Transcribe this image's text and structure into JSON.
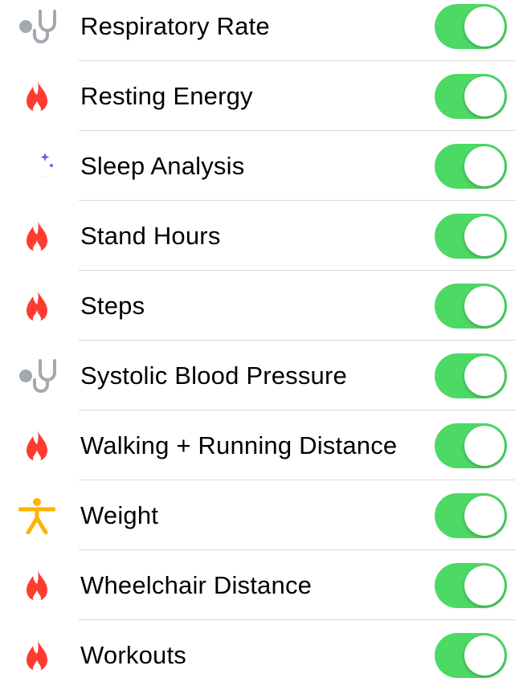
{
  "colors": {
    "toggle_on": "#4cd964",
    "flame": "#ff3b30",
    "moon": "#7d56f5",
    "stethoscope": "#a4a8b0",
    "figure": "#ffb300"
  },
  "items": [
    {
      "label": "Respiratory Rate",
      "icon": "stethoscope-icon",
      "enabled": true
    },
    {
      "label": "Resting Energy",
      "icon": "flame-icon",
      "enabled": true
    },
    {
      "label": "Sleep Analysis",
      "icon": "moon-icon",
      "enabled": true
    },
    {
      "label": "Stand Hours",
      "icon": "flame-icon",
      "enabled": true
    },
    {
      "label": "Steps",
      "icon": "flame-icon",
      "enabled": true
    },
    {
      "label": "Systolic Blood Pressure",
      "icon": "stethoscope-icon",
      "enabled": true
    },
    {
      "label": "Walking + Running Distance",
      "icon": "flame-icon",
      "enabled": true
    },
    {
      "label": "Weight",
      "icon": "figure-icon",
      "enabled": true
    },
    {
      "label": "Wheelchair Distance",
      "icon": "flame-icon",
      "enabled": true
    },
    {
      "label": "Workouts",
      "icon": "flame-icon",
      "enabled": true
    }
  ]
}
